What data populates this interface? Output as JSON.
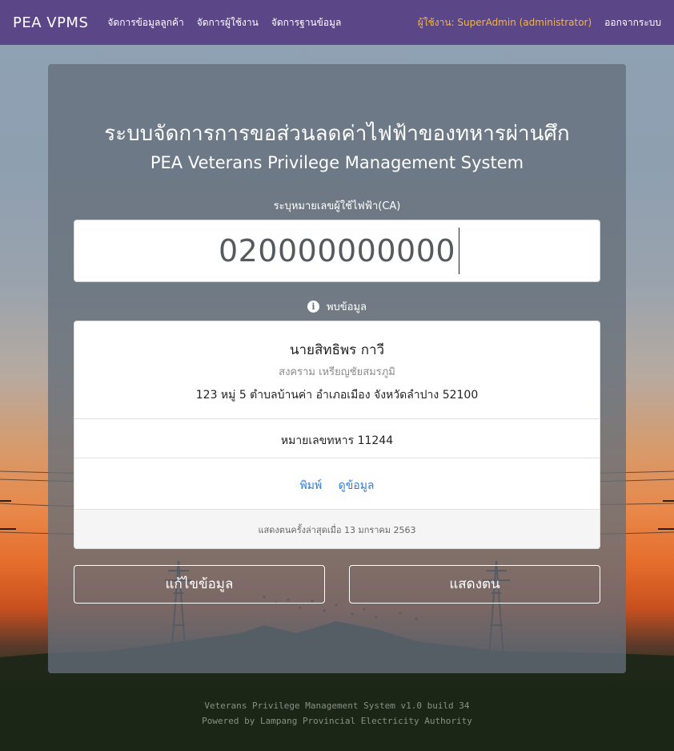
{
  "navbar": {
    "brand": "PEA VPMS",
    "links": [
      "จัดการข้อมูลลูกค้า",
      "จัดการผู้ใช้งาน",
      "จัดการฐานข้อมูล"
    ],
    "user": "ผู้ใช้งาน: SuperAdmin (administrator)",
    "logout": "ออกจากระบบ",
    "colors": {
      "background": "#5b4687",
      "user": "#f7b733"
    }
  },
  "header": {
    "title_th": "ระบบจัดการการขอส่วนลดค่าไฟฟ้าของทหารผ่านศึก",
    "title_en": "PEA Veterans Privilege Management System"
  },
  "search": {
    "label": "ระบุหมายเลขผู้ใช้ไฟฟ้า(CA)",
    "value": "020000000000"
  },
  "result": {
    "status_icon": "info-icon",
    "status": "พบข้อมูล",
    "name": "นายสิทธิพร  กาวี",
    "rank": "สงคราม เหรียญชัยสมรภูมิ",
    "address": "123 หมู่ 5 ตำบลบ้านค่า อำเภอเมือง จังหวัดลำปาง 52100",
    "soldier_id": "หมายเลขทหาร 11244",
    "print_link": "พิมพ์",
    "view_link": "ดูข้อมูล",
    "last_shown": "แสดงตนครั้งล่าสุดเมื่อ 13 มกราคม 2563",
    "link_color": "#2f7bd8"
  },
  "actions": {
    "edit": "แก้ไขข้อมูล",
    "show": "แสดงตน"
  },
  "footer": {
    "line1": "Veterans Privilege Management System v1.0 build 34",
    "line2": "Powered by Lampang Provincial Electricity Authority"
  }
}
